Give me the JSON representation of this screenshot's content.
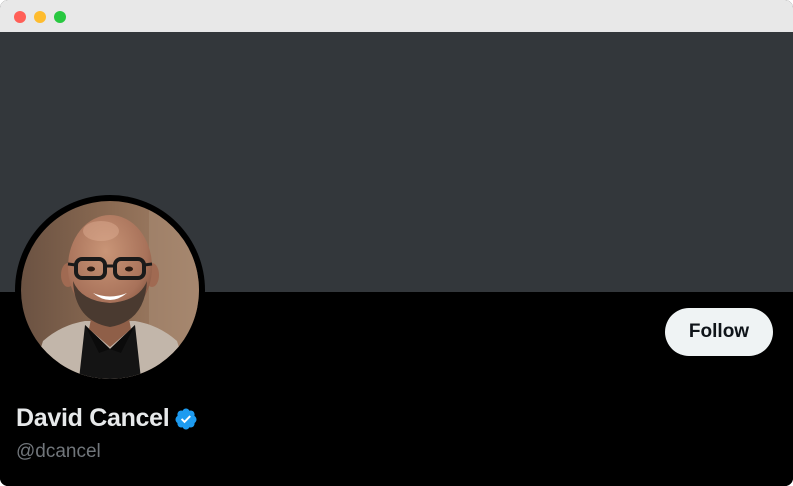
{
  "window": {
    "controls": [
      "close",
      "minimize",
      "maximize"
    ]
  },
  "profile": {
    "display_name": "David Cancel",
    "handle": "@dcancel",
    "verified": true,
    "verified_icon": "verified-badge-icon",
    "follow_label": "Follow"
  },
  "colors": {
    "banner": "#33373b",
    "background": "#000000",
    "name_text": "#e7e9ea",
    "handle_text": "#71767b",
    "follow_button_bg": "#eff3f4",
    "verified_badge": "#1d9bf0"
  }
}
